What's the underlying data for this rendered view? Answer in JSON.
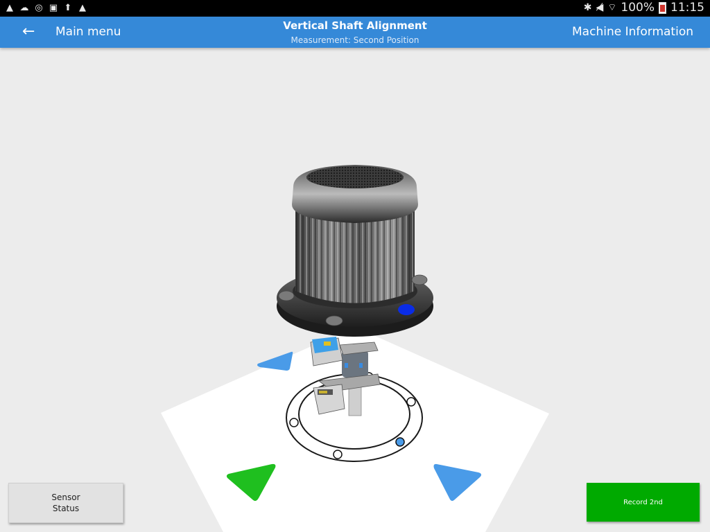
{
  "status_bar": {
    "left_icons": [
      "warning-icon",
      "cloud-icon",
      "sync-icon",
      "onenote-icon",
      "upload-icon",
      "warning-icon"
    ],
    "right_icons": [
      "bluetooth-icon",
      "mute-icon",
      "wifi-icon"
    ],
    "battery": "100%",
    "time": "11:15"
  },
  "app_bar": {
    "back_label": "Main menu",
    "title": "Vertical Shaft Alignment",
    "subtitle": "Measurement: Second Position",
    "right_action": "Machine Information"
  },
  "scene": {
    "description": "3D view of vertical motor with alignment sensors on coupling",
    "arrows": [
      {
        "position": "back-left",
        "color": "#4a9be8",
        "state": "pending"
      },
      {
        "position": "front-left",
        "color": "#1fbf1f",
        "state": "current"
      },
      {
        "position": "front-right",
        "color": "#4a9be8",
        "state": "pending"
      }
    ],
    "flange_bolt_marker_color": "#0a2ce6",
    "ring_marker_color": "#4a9be8"
  },
  "buttons": {
    "sensor_status_line1": "Sensor",
    "sensor_status_line2": "Status",
    "record": "Record 2nd"
  }
}
